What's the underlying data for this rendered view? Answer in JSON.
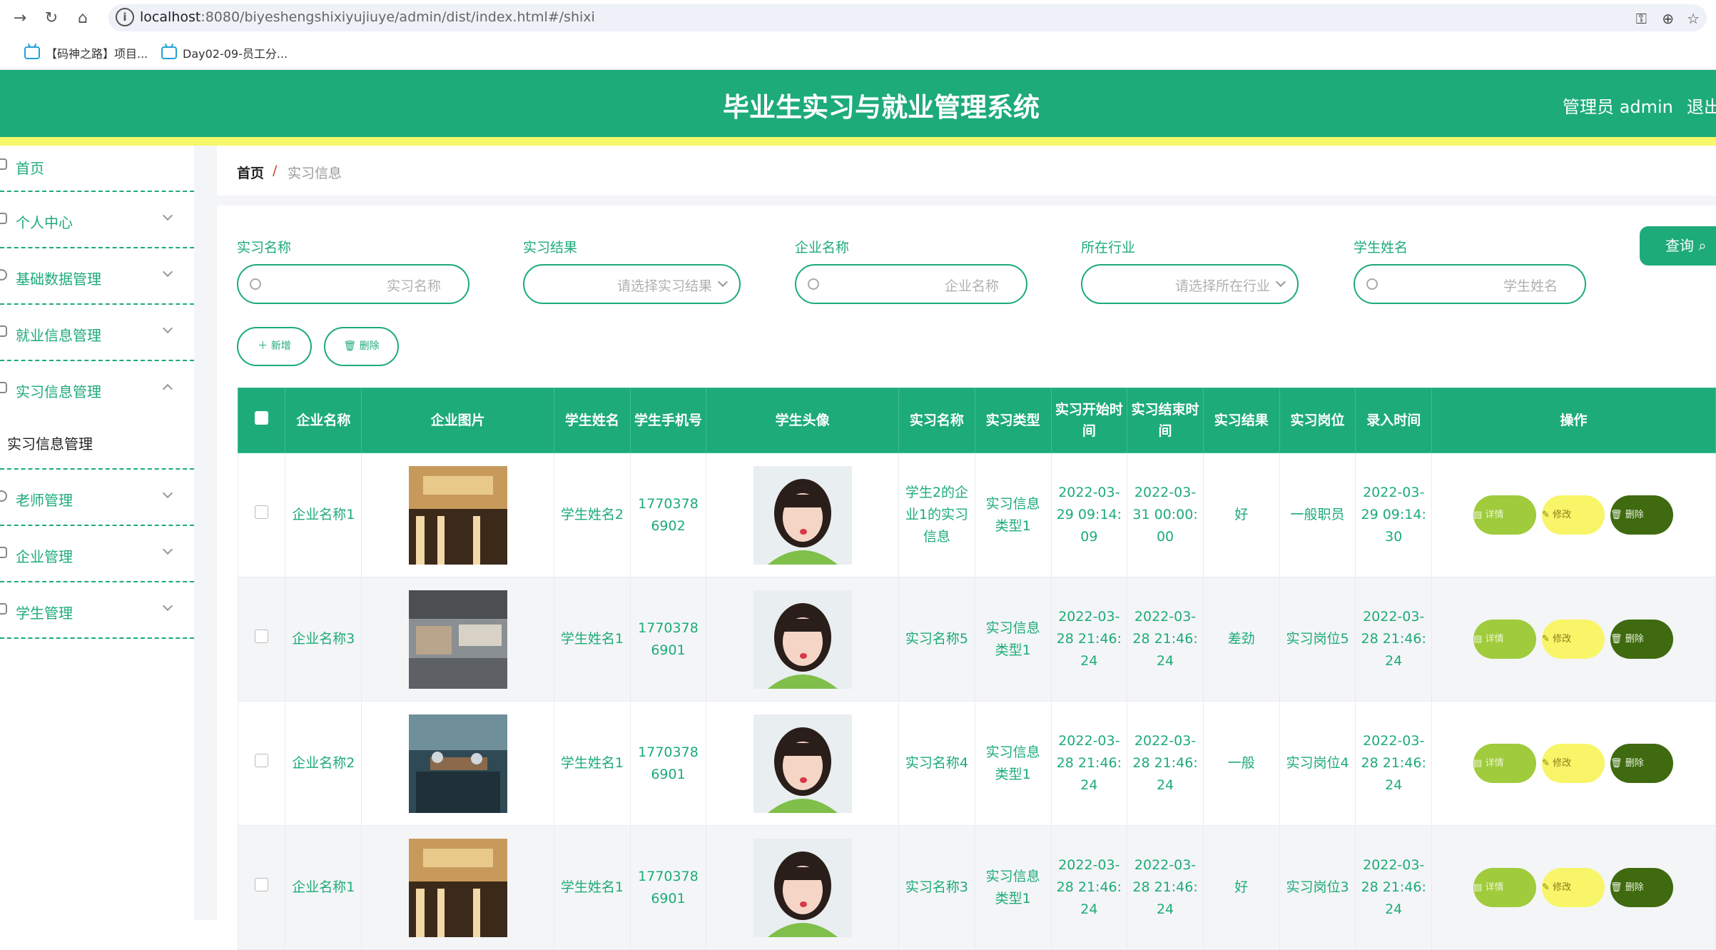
{
  "browser": {
    "url_host": "localhost",
    "url_rest": ":8080/biyeshengshixiyujiuye/admin/dist/index.html#/shixi",
    "bookmarks": [
      "【码神之路】项目...",
      "Day02-09-员工分..."
    ]
  },
  "header": {
    "title": "毕业生实习与就业管理系统",
    "user": "管理员 admin",
    "logout": "退出"
  },
  "sidebar": {
    "items": [
      {
        "label": "首页"
      },
      {
        "label": "个人中心"
      },
      {
        "label": "基础数据管理"
      },
      {
        "label": "就业信息管理"
      },
      {
        "label": "实习信息管理"
      },
      {
        "label": "老师管理"
      },
      {
        "label": "企业管理"
      },
      {
        "label": "学生管理"
      }
    ],
    "submenu": "实习信息管理"
  },
  "breadcrumb": {
    "home": "首页",
    "sep": "/",
    "current": "实习信息"
  },
  "filters": {
    "f1": {
      "label": "实习名称",
      "placeholder": "实习名称"
    },
    "f2": {
      "label": "实习结果",
      "placeholder": "请选择实习结果"
    },
    "f3": {
      "label": "企业名称",
      "placeholder": "企业名称"
    },
    "f4": {
      "label": "所在行业",
      "placeholder": "请选择所在行业"
    },
    "f5": {
      "label": "学生姓名",
      "placeholder": "学生姓名"
    },
    "query": "查询"
  },
  "actions": {
    "add": "新增",
    "delete": "删除"
  },
  "table": {
    "headers": [
      "企业名称",
      "企业图片",
      "学生姓名",
      "学生手机号",
      "学生头像",
      "实习名称",
      "实习类型",
      "实习开始时间",
      "实习结束时间",
      "实习结果",
      "实习岗位",
      "录入时间",
      "操作"
    ],
    "btn_detail": "详情",
    "btn_edit": "修改",
    "btn_delete": "删除",
    "rows": [
      {
        "company": "企业名称1",
        "student": "学生姓名2",
        "phone": "17703786902",
        "name": "学生2的企业1的实习信息",
        "type": "实习信息类型1",
        "start": "2022-03-29 09:14:09",
        "end": "2022-03-31 00:00:00",
        "result": "好",
        "post": "一般职员",
        "created": "2022-03-29 09:14:30"
      },
      {
        "company": "企业名称3",
        "student": "学生姓名1",
        "phone": "17703786901",
        "name": "实习名称5",
        "type": "实习信息类型1",
        "start": "2022-03-28 21:46:24",
        "end": "2022-03-28 21:46:24",
        "result": "差劲",
        "post": "实习岗位5",
        "created": "2022-03-28 21:46:24"
      },
      {
        "company": "企业名称2",
        "student": "学生姓名1",
        "phone": "17703786901",
        "name": "实习名称4",
        "type": "实习信息类型1",
        "start": "2022-03-28 21:46:24",
        "end": "2022-03-28 21:46:24",
        "result": "一般",
        "post": "实习岗位4",
        "created": "2022-03-28 21:46:24"
      },
      {
        "company": "企业名称1",
        "student": "学生姓名1",
        "phone": "17703786901",
        "name": "实习名称3",
        "type": "实习信息类型1",
        "start": "2022-03-28 21:46:24",
        "end": "2022-03-28 21:46:24",
        "result": "好",
        "post": "实习岗位3",
        "created": "2022-03-28 21:46:24"
      }
    ]
  },
  "colors": {
    "primary": "#1dab79",
    "stripe": "#f7f76a",
    "detail": "#9fcb3c",
    "edit": "#f8f569",
    "delete": "#3f6a10"
  }
}
